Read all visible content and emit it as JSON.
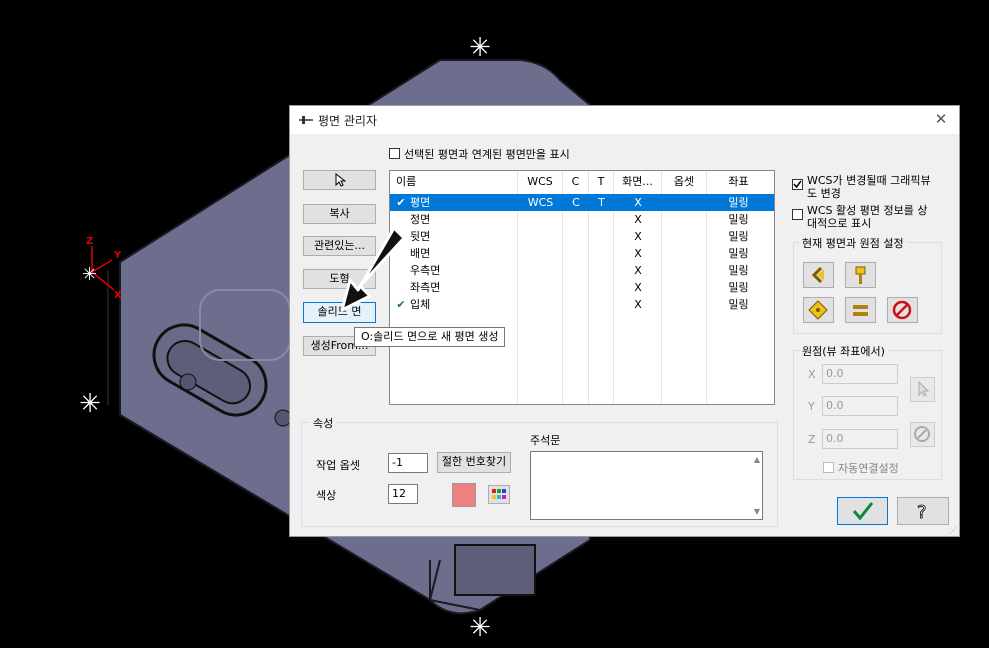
{
  "dialog": {
    "title": "평면 관리자",
    "show_linked_label": "선택된 평면과 연계된 평면만을 표시"
  },
  "left_buttons": {
    "copy": "복사",
    "related": "관련있는...",
    "geometry": "도형",
    "solid_face": "솔리드 면",
    "create_from": "생성From..."
  },
  "tooltip": "O:솔리드 면으로 새 평면 생성",
  "table": {
    "headers": [
      "이름",
      "WCS",
      "C",
      "T",
      "화면...",
      "옵셋",
      "좌표"
    ],
    "rows": [
      {
        "check": "✔",
        "name": "평면",
        "wcs": "WCS",
        "c": "C",
        "t": "T",
        "view": "X",
        "offset": "",
        "coord": "밀링"
      },
      {
        "check": "",
        "name": "정면",
        "wcs": "",
        "c": "",
        "t": "",
        "view": "X",
        "offset": "",
        "coord": "밀링"
      },
      {
        "check": "",
        "name": "뒷면",
        "wcs": "",
        "c": "",
        "t": "",
        "view": "X",
        "offset": "",
        "coord": "밀링"
      },
      {
        "check": "",
        "name": "배면",
        "wcs": "",
        "c": "",
        "t": "",
        "view": "X",
        "offset": "",
        "coord": "밀링"
      },
      {
        "check": "",
        "name": "우측면",
        "wcs": "",
        "c": "",
        "t": "",
        "view": "X",
        "offset": "",
        "coord": "밀링"
      },
      {
        "check": "",
        "name": "좌측면",
        "wcs": "",
        "c": "",
        "t": "",
        "view": "X",
        "offset": "",
        "coord": "밀링"
      },
      {
        "check": "✔",
        "name": "입체",
        "wcs": "",
        "c": "",
        "t": "",
        "view": "X",
        "offset": "",
        "coord": "밀링"
      }
    ]
  },
  "properties": {
    "group_label": "속성",
    "work_offset_label": "작업 옵셋",
    "work_offset_value": "-1",
    "find_number_button": "절한 번호찾기",
    "color_label": "색상",
    "color_value": "12",
    "color_swatch": "#f08080",
    "comment_label": "주석문"
  },
  "right": {
    "wcs_change_label_1": "WCS가 변경될때 그래픽뷰",
    "wcs_change_label_2": "도 변경",
    "wcs_active_label_1": "WCS 활성 평면 정보를 상",
    "wcs_active_label_2": "대적으로 표시",
    "current_plane_group": "현재 평면과 원점 설정",
    "origin_group": "원점(뷰 좌표에서)",
    "x_label": "X",
    "x_value": "0.0",
    "y_label": "Y",
    "y_value": "0.0",
    "z_label": "Z",
    "z_value": "0.0",
    "auto_link_label": "자동연결설정"
  },
  "viewport_axes": {
    "z": "Z",
    "y": "Y",
    "x": "X"
  },
  "colors": {
    "accent": "#0078d7",
    "model_fill": "#6e6e8e",
    "check_green": "#1a7a4a"
  }
}
